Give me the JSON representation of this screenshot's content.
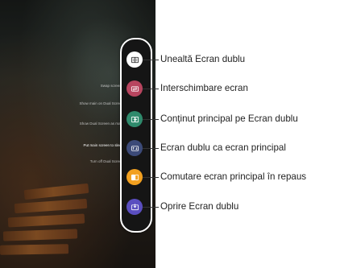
{
  "phone_menu": {
    "items": [
      "Swap screens",
      "Show main on Dual Screen",
      "Show Dual Screen as main",
      "Put main screen to sleep",
      "Turn off Dual Screen"
    ]
  },
  "dual_screen_panel": {
    "buttons": [
      {
        "icon": "dual-screen-tool-icon",
        "color": "#ffffff"
      },
      {
        "icon": "swap-screens-icon",
        "color": "#b8455f"
      },
      {
        "icon": "main-content-icon",
        "color": "#2f8a6c"
      },
      {
        "icon": "dual-as-main-icon",
        "color": "#3c4a78"
      },
      {
        "icon": "main-screen-sleep-icon",
        "color": "#f2a020"
      },
      {
        "icon": "dual-screen-off-icon",
        "color": "#5a4ec0"
      }
    ]
  },
  "callouts": [
    "Unealtă Ecran dublu",
    "Interschimbare ecran",
    "Conținut principal pe Ecran dublu",
    "Ecran dublu ca ecran principal",
    "Comutare ecran principal în repaus",
    "Oprire Ecran dublu"
  ]
}
